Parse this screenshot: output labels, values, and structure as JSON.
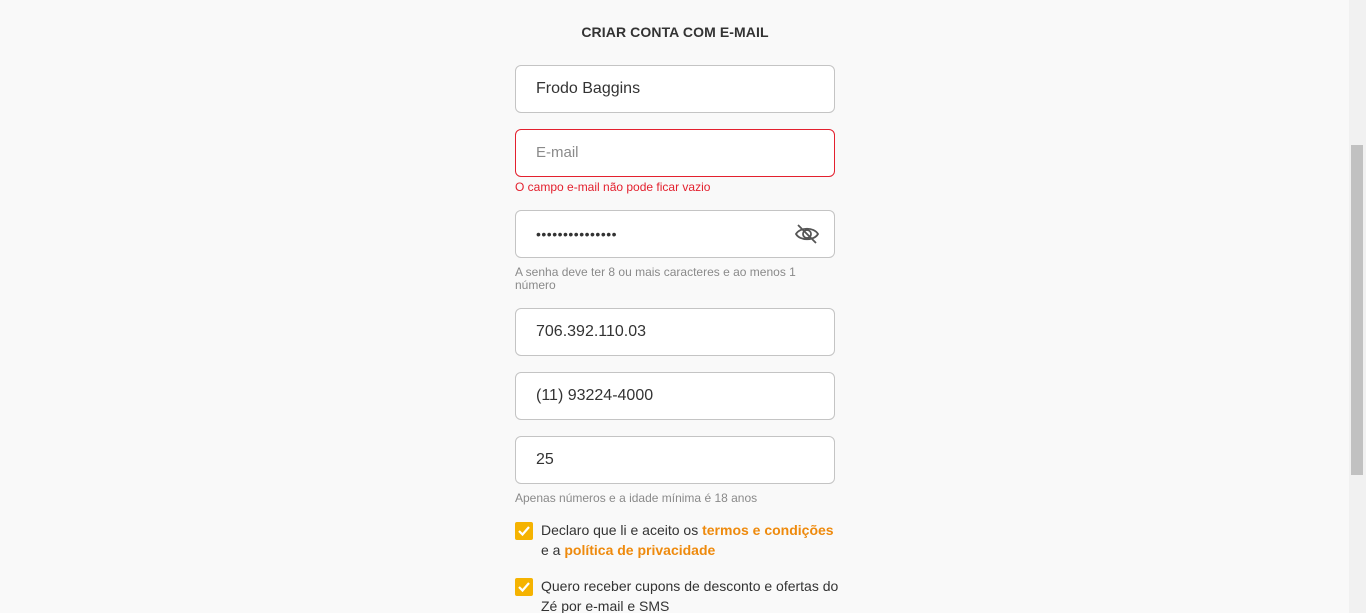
{
  "form": {
    "title": "CRIAR CONTA COM E-MAIL",
    "name_value": "Frodo Baggins",
    "email_value": "",
    "email_placeholder": "E-mail",
    "email_error": "O campo e-mail não pode ficar vazio",
    "password_value": "•••••••••••••••",
    "password_hint": "A senha deve ter 8 ou mais caracteres e ao menos 1 número",
    "cpf_value": "706.392.110.03",
    "phone_value": "(11) 93224-4000",
    "age_value": "25",
    "age_hint": "Apenas números e a idade mínima é 18 anos"
  },
  "terms": {
    "checked": true,
    "text_before": "Declaro que li e aceito os ",
    "terms_link": "termos e condições",
    "text_middle": " e a ",
    "privacy_link": "política de privacidade"
  },
  "offers": {
    "checked": true,
    "text": "Quero receber cupons de desconto e ofertas do Zé por e-mail e SMS"
  },
  "colors": {
    "accent": "#f5b301",
    "link": "#ee8a0d",
    "error": "#e3202e",
    "background": "#f9f9f9"
  },
  "icons": {
    "password_toggle": "eye-off-icon",
    "checkbox_mark": "checkmark-icon"
  }
}
